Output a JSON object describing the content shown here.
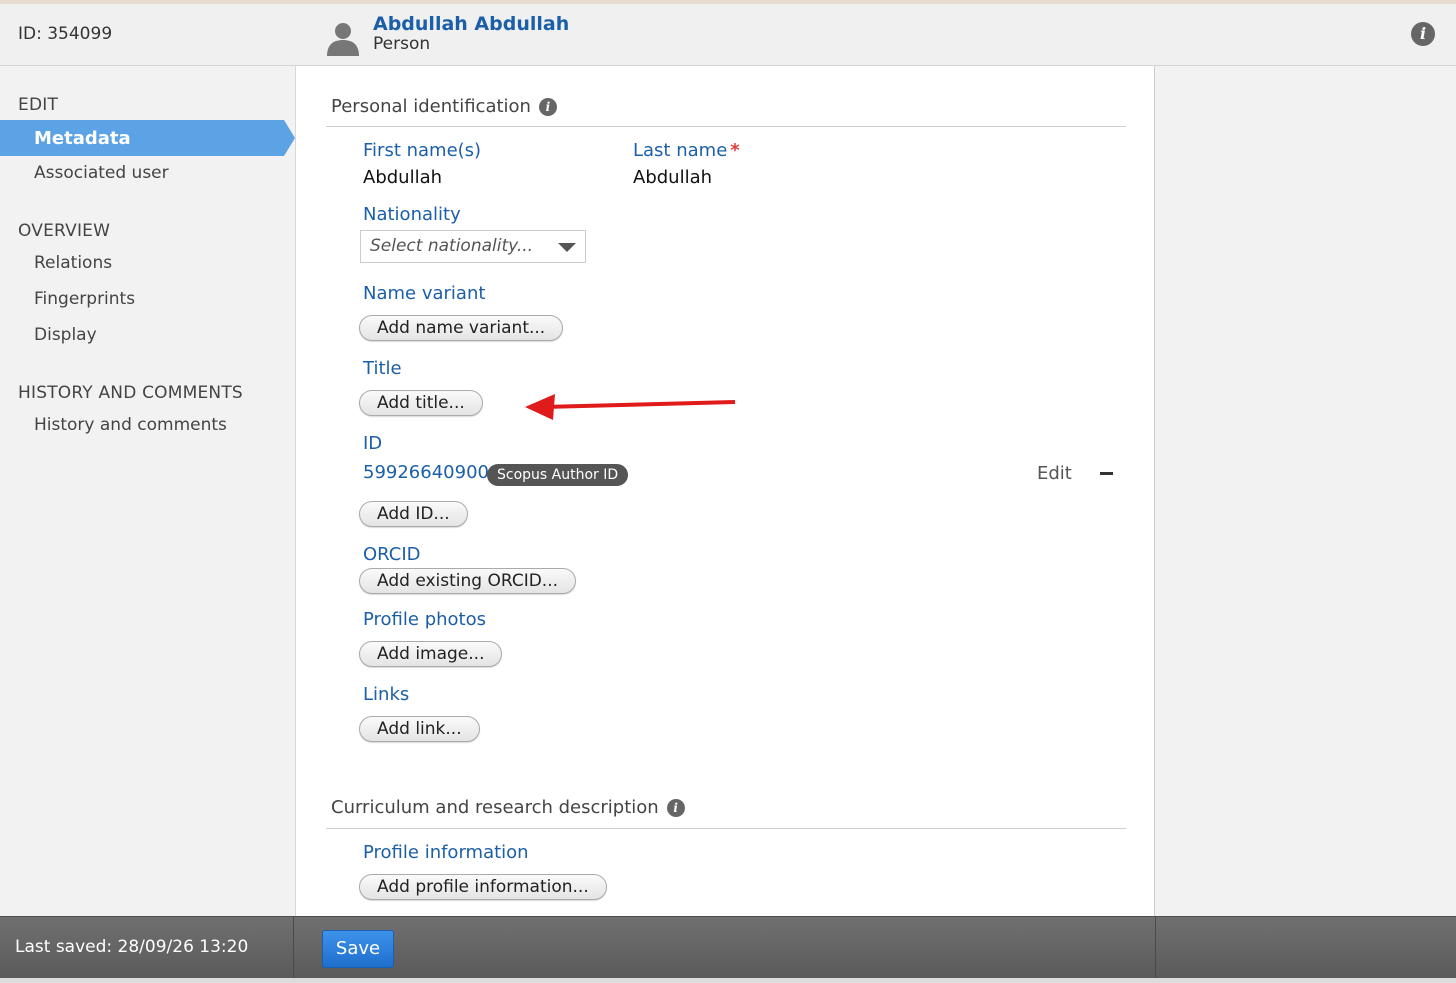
{
  "header": {
    "id_label": "ID: 354099",
    "name": "Abdullah Abdullah",
    "type": "Person"
  },
  "sidebar": {
    "edit_title": "EDIT",
    "edit_items": [
      "Metadata",
      "Associated user"
    ],
    "overview_title": "OVERVIEW",
    "overview_items": [
      "Relations",
      "Fingerprints",
      "Display"
    ],
    "history_title": "HISTORY AND COMMENTS",
    "history_items": [
      "History and comments"
    ]
  },
  "personal": {
    "section_title": "Personal identification",
    "first_name_label": "First name(s)",
    "first_name_value": "Abdullah",
    "last_name_label": "Last name",
    "last_name_value": "Abdullah",
    "nationality_label": "Nationality",
    "nationality_placeholder": "Select nationality...",
    "name_variant_label": "Name variant",
    "name_variant_button": "Add name variant...",
    "title_label": "Title",
    "title_button": "Add title...",
    "id_label": "ID",
    "id_value": "59926640900",
    "id_type_badge": "Scopus Author ID",
    "id_edit": "Edit",
    "id_button": "Add ID...",
    "orcid_label": "ORCID",
    "orcid_button": "Add existing ORCID...",
    "photos_label": "Profile photos",
    "photos_button": "Add image...",
    "links_label": "Links",
    "links_button": "Add link..."
  },
  "curriculum": {
    "section_title": "Curriculum and research description",
    "profile_label": "Profile information",
    "profile_button": "Add profile information..."
  },
  "footer": {
    "last_saved": "Last saved: 28/09/26 13:20",
    "save_label": "Save"
  },
  "colors": {
    "accent_blue": "#1b5fa8",
    "active_nav": "#5ba3e4",
    "annotation_arrow": "#e01b1b",
    "required_star": "#e23b3b"
  }
}
